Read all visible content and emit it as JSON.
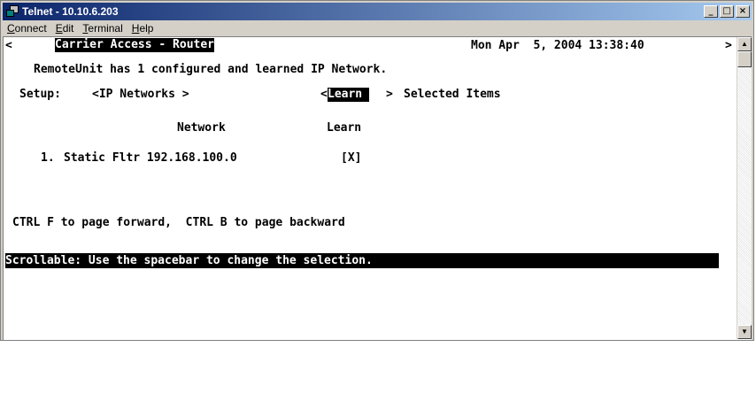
{
  "window": {
    "title": "Telnet - 10.10.6.203",
    "minimize_glyph": "_",
    "maximize_glyph": "□",
    "close_glyph": "×"
  },
  "menu": {
    "items": [
      {
        "label_u": "C",
        "label_rest": "onnect"
      },
      {
        "label_u": "E",
        "label_rest": "dit"
      },
      {
        "label_u": "T",
        "label_rest": "erminal"
      },
      {
        "label_u": "H",
        "label_rest": "elp"
      }
    ]
  },
  "terminal": {
    "header_left_arrow": "<",
    "header_title": "Carrier Access - Router",
    "header_datetime": "Mon Apr  5, 2004 13:38:40",
    "header_right_arrow": ">",
    "status_message": "RemoteUnit has 1 configured and learned IP Network.",
    "setup_label": "Setup:",
    "setup_menu": "<IP Networks >",
    "learn_open": "<",
    "learn_label": "Learn ",
    "learn_close": ">",
    "selected_items": "Selected Items",
    "col_network": "Network",
    "col_learn": "Learn",
    "rows": [
      {
        "index": "1.",
        "network": "Static Fltr 192.168.100.0",
        "learn": "[X]"
      }
    ],
    "paging_hint": "CTRL F to page forward,  CTRL B to page backward",
    "footer_hint": "Scrollable: Use the spacebar to change the selection."
  },
  "scrollbar": {
    "up_glyph": "▲",
    "down_glyph": "▼"
  },
  "colors": {
    "titlebar_start": "#0a246a",
    "titlebar_end": "#a6caf0",
    "terminal_bg": "#ffffff",
    "terminal_fg": "#000000",
    "chrome": "#d4d0c8"
  }
}
